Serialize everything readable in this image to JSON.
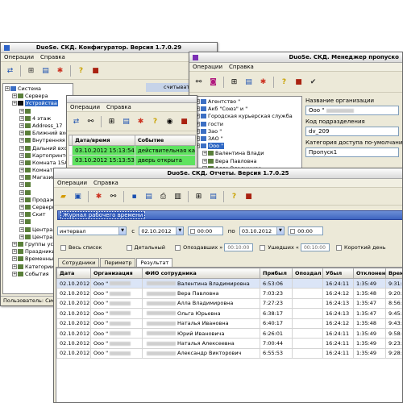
{
  "config_window": {
    "title": "DuoSe. СКД. Конфигуратор. Версия  1.7.0.29",
    "menu": [
      "Операции",
      "Справка"
    ],
    "right_header": "считыватель",
    "tree": [
      {
        "label": "Система",
        "depth": 0
      },
      {
        "label": "Сервера",
        "depth": 1
      },
      {
        "label": "Устройства",
        "depth": 1,
        "selected": true
      },
      {
        "label": "",
        "depth": 2
      },
      {
        "label": "4 этаж",
        "depth": 2
      },
      {
        "label": "Address_17",
        "depth": 2
      },
      {
        "label": "Ближний вход",
        "depth": 2
      },
      {
        "label": "Внутренняя пр",
        "depth": 2
      },
      {
        "label": "Дальний вход",
        "depth": 2
      },
      {
        "label": "Картопринтер",
        "depth": 2
      },
      {
        "label": "Комната 15А",
        "depth": 2
      },
      {
        "label": "Комната",
        "depth": 2
      },
      {
        "label": "Магазин",
        "depth": 2
      },
      {
        "label": "",
        "depth": 2
      },
      {
        "label": "",
        "depth": 2
      },
      {
        "label": "Продаж",
        "depth": 2
      },
      {
        "label": "Серверн",
        "depth": 2
      },
      {
        "label": "Скит",
        "depth": 2
      },
      {
        "label": "",
        "depth": 2
      },
      {
        "label": "Централ",
        "depth": 2
      },
      {
        "label": "Централ",
        "depth": 2
      },
      {
        "label": "Группы устр",
        "depth": 1
      },
      {
        "label": "Праздники",
        "depth": 1
      },
      {
        "label": "Временные з",
        "depth": 1
      },
      {
        "label": "Категории д",
        "depth": 1
      },
      {
        "label": "События",
        "depth": 1
      }
    ],
    "status": "Пользователь: Сис"
  },
  "manager_window": {
    "title": "DuoSe. СКД. Менеджер пропуско",
    "menu": [
      "Операции",
      "Справка"
    ],
    "tree": [
      {
        "label": "Агентство \"",
        "depth": 0
      },
      {
        "label": "Акб \"Союз\" и \"",
        "depth": 0
      },
      {
        "label": "Городская курьерская служба",
        "depth": 0
      },
      {
        "label": "гости",
        "depth": 0
      },
      {
        "label": "Зао \"",
        "depth": 0
      },
      {
        "label": "ЗАО \"",
        "depth": 0
      },
      {
        "label": "Ооо \"",
        "depth": 0,
        "selected": true
      },
      {
        "label": "Валентина Влади",
        "depth": 1
      },
      {
        "label": "Вера Павловна",
        "depth": 1
      },
      {
        "label": "Алла Владимиро",
        "depth": 1
      },
      {
        "label": "",
        "depth": 1
      }
    ],
    "org_name_label": "Название организации",
    "org_name_value": "Ооо \"",
    "dept_code_label": "Код подразделения",
    "dept_code_value": "dv_209",
    "access_cat_label": "Категория доступа по-умолчани",
    "access_cat_value": "Пропуск1"
  },
  "events_window": {
    "menu": [
      "Операции",
      "Справка"
    ],
    "columns": [
      "Дата/время",
      "Событие"
    ],
    "rows": [
      {
        "datetime": "03.10.2012 15:13:54",
        "event": "действительная ка"
      },
      {
        "datetime": "03.10.2012 15:13:53",
        "event": "дверь открыта"
      }
    ]
  },
  "reports_window": {
    "title": "DuoSe. СКД. Отчеты. Версия  1.7.0.25",
    "menu": [
      "Операции",
      "Справка"
    ],
    "report_type": "Журнал рабочего времени",
    "period_mode": "интервал",
    "from_label": "с",
    "from_date": "02.10.2012",
    "from_time": "00:00",
    "to_label": "по",
    "to_date": "03.10.2012",
    "to_time": "00:00",
    "options": [
      {
        "label": "Весь список"
      },
      {
        "label": "Детальный"
      },
      {
        "label": "Опоздавших »",
        "value": "00:10:00"
      },
      {
        "label": "Ушедших «",
        "value": "00:10:00"
      },
      {
        "label": "Короткий день"
      }
    ],
    "tabs": [
      "Сотрудники",
      "Периметр",
      "Результат"
    ],
    "active_tab": 2,
    "columns": [
      "Дата",
      "Организация",
      "ФИО сотрудника",
      "Прибыл",
      "Опоздал",
      "Убыл",
      "Отклонен",
      "Время"
    ],
    "rows": [
      {
        "date": "02.10.2012",
        "org": "Ооо \"",
        "name": "Валентина Владимировна",
        "arrived": "6:53:06",
        "late": "",
        "left": "16:24:11",
        "dev": "1:35:49",
        "time": "9:31:0",
        "selected": true
      },
      {
        "date": "02.10.2012",
        "org": "Ооо \"",
        "name": "Вера Павловна",
        "arrived": "7:03:23",
        "late": "",
        "left": "16:24:12",
        "dev": "1:35:48",
        "time": "9:20:4"
      },
      {
        "date": "02.10.2012",
        "org": "Ооо \"",
        "name": "Алла Владимировна",
        "arrived": "7:27:23",
        "late": "",
        "left": "16:24:13",
        "dev": "1:35:47",
        "time": "8:56:5"
      },
      {
        "date": "02.10.2012",
        "org": "Ооо \"",
        "name": "Ольга Юрьевна",
        "arrived": "6:38:17",
        "late": "",
        "left": "16:24:13",
        "dev": "1:35:47",
        "time": "9:45:5"
      },
      {
        "date": "02.10.2012",
        "org": "Ооо \"",
        "name": "Наталья Ивановна",
        "arrived": "6:40:17",
        "late": "",
        "left": "16:24:12",
        "dev": "1:35:48",
        "time": "9:43:5"
      },
      {
        "date": "02.10.2012",
        "org": "Ооо \"",
        "name": "Юрий Ивановича",
        "arrived": "6:26:01",
        "late": "",
        "left": "16:24:11",
        "dev": "1:35:49",
        "time": "9:58:1"
      },
      {
        "date": "02.10.2012",
        "org": "Ооо \"",
        "name": "Наталья Алексеевна",
        "arrived": "7:00:44",
        "late": "",
        "left": "16:24:11",
        "dev": "1:35:49",
        "time": "9:23:2"
      },
      {
        "date": "02.10.2012",
        "org": "Ооо \"",
        "name": "Александр Викторович",
        "arrived": "6:55:53",
        "late": "",
        "left": "16:24:11",
        "dev": "1:35:49",
        "time": "9:28:1"
      }
    ]
  }
}
